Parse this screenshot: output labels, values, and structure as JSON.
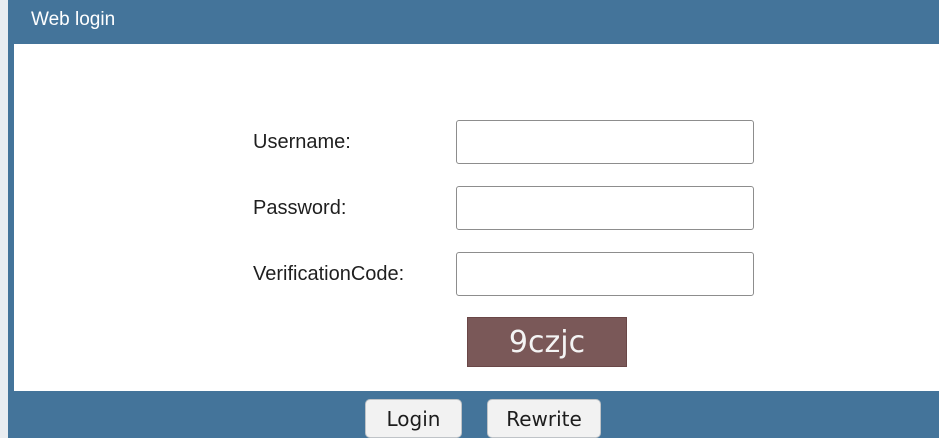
{
  "window": {
    "title": "Web login"
  },
  "form": {
    "username_label": "Username:",
    "password_label": "Password:",
    "verification_label": "VerificationCode:",
    "username_value": "",
    "password_value": "",
    "verification_value": "",
    "captcha_text": "9czjc"
  },
  "actions": {
    "login_label": "Login",
    "rewrite_label": "Rewrite"
  },
  "colors": {
    "header_footer_bg": "#44749a",
    "content_bg": "#ffffff",
    "captcha_bg": "#7a5858"
  }
}
